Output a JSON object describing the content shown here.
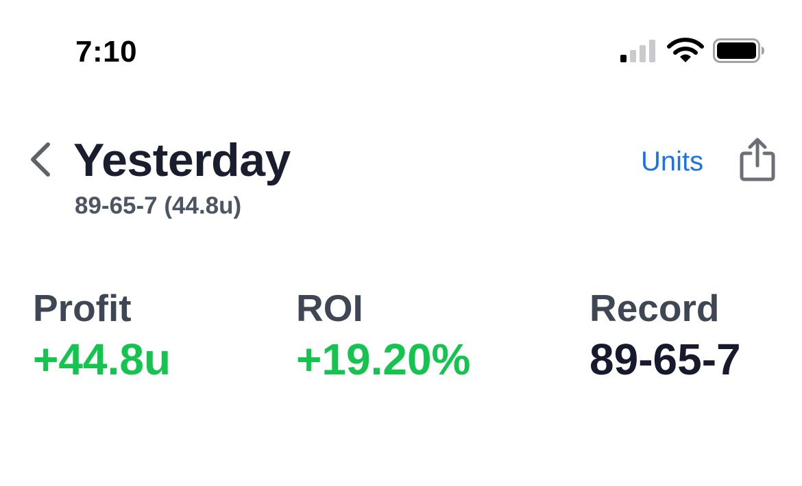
{
  "status_bar": {
    "time": "7:10",
    "signal_bars_active": 1,
    "signal_bars_total": 4,
    "wifi_icon": "wifi-icon",
    "battery_level_percent": 100
  },
  "header": {
    "back_icon": "chevron-left-icon",
    "title": "Yesterday",
    "subtitle": "89-65-7 (44.8u)",
    "units_label": "Units",
    "share_icon": "share-icon"
  },
  "stats": {
    "profit": {
      "label": "Profit",
      "value": "+44.8u"
    },
    "roi": {
      "label": "ROI",
      "value": "+19.20%"
    },
    "record": {
      "label": "Record",
      "value": "89-65-7"
    }
  },
  "colors": {
    "positive": "#14c44e",
    "accent": "#1a73e8",
    "title": "#1a1d2e",
    "label": "#3f4754"
  }
}
